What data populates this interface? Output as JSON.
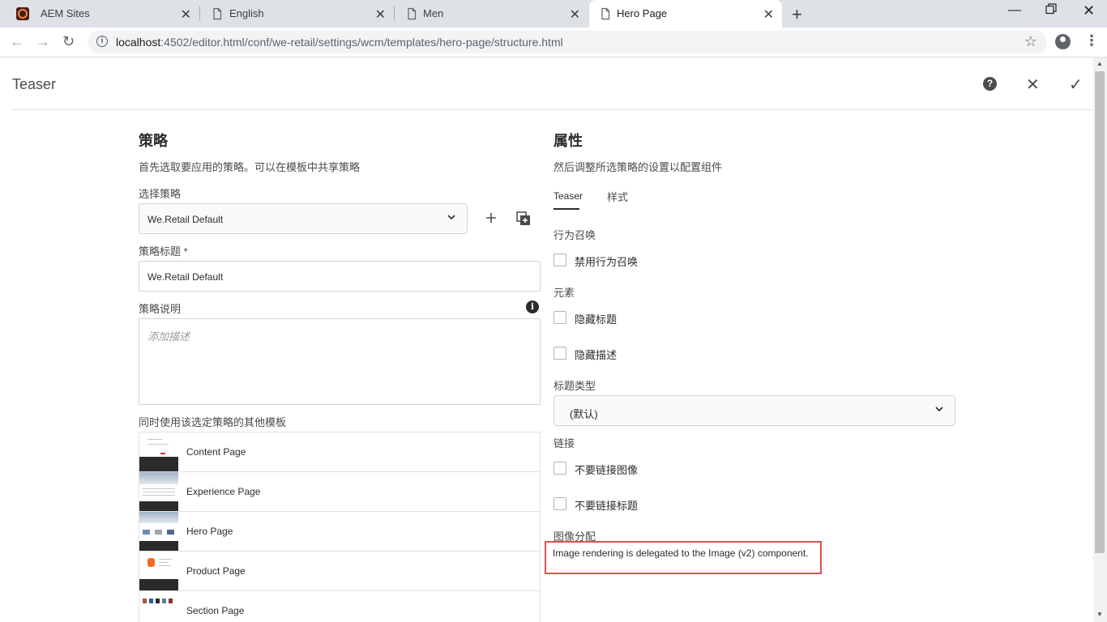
{
  "browser": {
    "tabs": [
      {
        "label": "AEM Sites",
        "icon": "aem-icon",
        "active": false
      },
      {
        "label": "English",
        "icon": "page-icon",
        "active": false
      },
      {
        "label": "Men",
        "icon": "page-icon",
        "active": false
      },
      {
        "label": "Hero Page",
        "icon": "page-icon",
        "active": true
      }
    ],
    "url_host": "localhost",
    "url_path": ":4502/editor.html/conf/we-retail/settings/wcm/templates/hero-page/structure.html"
  },
  "dialog": {
    "title": "Teaser"
  },
  "policy": {
    "heading": "策略",
    "subtitle": "首先选取要应用的策略。可以在模板中共享策略",
    "select_label": "选择策略",
    "selected": "We.Retail Default",
    "title_label": "策略标题 *",
    "title_value": "We.Retail Default",
    "desc_label": "策略说明",
    "desc_placeholder": "添加描述",
    "templates_label": "同时使用该选定策略的其他模板",
    "templates": [
      {
        "name": "Content Page"
      },
      {
        "name": "Experience Page"
      },
      {
        "name": "Hero Page"
      },
      {
        "name": "Product Page"
      },
      {
        "name": "Section Page"
      }
    ]
  },
  "properties": {
    "heading": "属性",
    "subtitle": "然后调整所选策略的设置以配置组件",
    "tabs": [
      "Teaser",
      "样式"
    ],
    "cta_section": "行为召唤",
    "cta_disable": "禁用行为召唤",
    "elements_section": "元素",
    "hide_title": "隐藏标题",
    "hide_desc": "隐藏描述",
    "title_type_label": "标题类型",
    "title_type_value": "(默认)",
    "link_section": "链接",
    "no_link_image": "不要链接图像",
    "no_link_title": "不要链接标题",
    "image_section": "图像分配",
    "image_note": "Image rendering is delegated to the Image (v2) component."
  },
  "colors": {
    "highlight_box": "#d9534f",
    "aem_brand": "#eb1000"
  }
}
